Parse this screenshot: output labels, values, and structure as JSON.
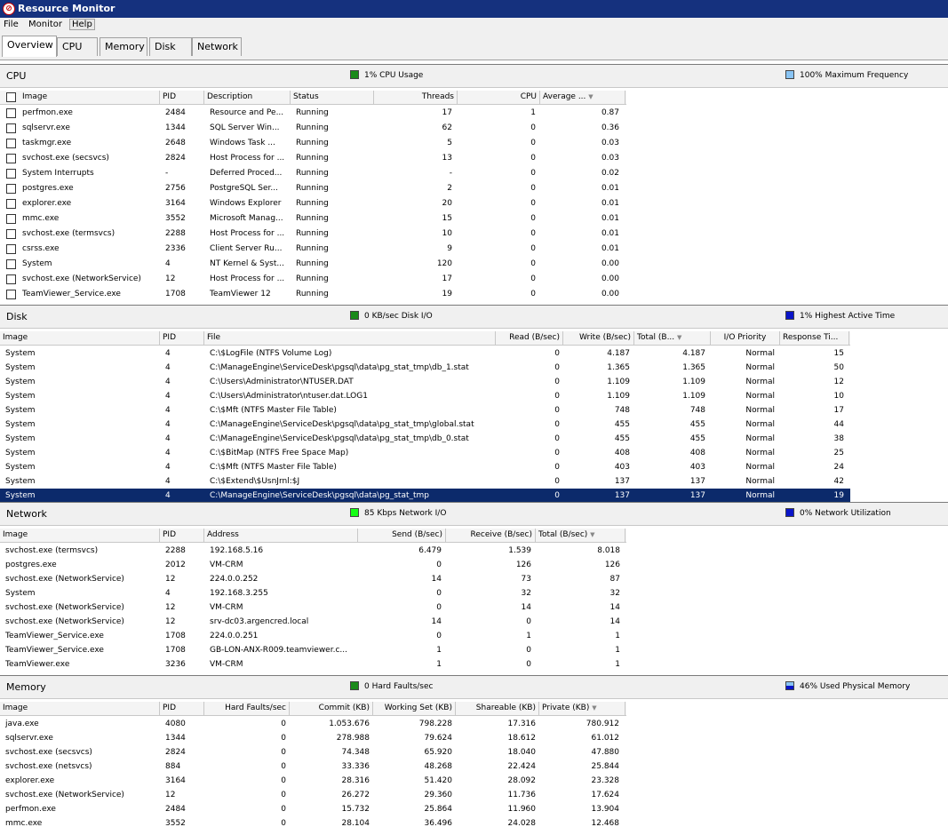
{
  "window": {
    "title": "Resource Monitor",
    "icon": "resource-monitor-icon"
  },
  "menu": [
    "File",
    "Monitor",
    "Help"
  ],
  "tabs": [
    "Overview",
    "CPU",
    "Memory",
    "Disk",
    "Network"
  ],
  "colors": {
    "green": "#1a8a1a",
    "lightblue": "#89c4f4",
    "blue": "#0a14c8",
    "brightgreen": "#14ff14",
    "selected": "#0c2a6b"
  },
  "cpu": {
    "title": "CPU",
    "indicator1": "1% CPU Usage",
    "indicator2": "100% Maximum Frequency",
    "columns": [
      "Image",
      "PID",
      "Description",
      "Status",
      "Threads",
      "CPU",
      "Average ..."
    ],
    "rows": [
      [
        "perfmon.exe",
        "2484",
        "Resource and Pe...",
        "Running",
        "17",
        "1",
        "0.87"
      ],
      [
        "sqlservr.exe",
        "1344",
        "SQL Server Win...",
        "Running",
        "62",
        "0",
        "0.36"
      ],
      [
        "taskmgr.exe",
        "2648",
        "Windows Task ...",
        "Running",
        "5",
        "0",
        "0.03"
      ],
      [
        "svchost.exe (secsvcs)",
        "2824",
        "Host Process for ...",
        "Running",
        "13",
        "0",
        "0.03"
      ],
      [
        "System Interrupts",
        "-",
        "Deferred Proced...",
        "Running",
        "-",
        "0",
        "0.02"
      ],
      [
        "postgres.exe",
        "2756",
        "PostgreSQL Ser...",
        "Running",
        "2",
        "0",
        "0.01"
      ],
      [
        "explorer.exe",
        "3164",
        "Windows Explorer",
        "Running",
        "20",
        "0",
        "0.01"
      ],
      [
        "mmc.exe",
        "3552",
        "Microsoft Manag...",
        "Running",
        "15",
        "0",
        "0.01"
      ],
      [
        "svchost.exe (termsvcs)",
        "2288",
        "Host Process for ...",
        "Running",
        "10",
        "0",
        "0.01"
      ],
      [
        "csrss.exe",
        "2336",
        "Client Server Ru...",
        "Running",
        "9",
        "0",
        "0.01"
      ],
      [
        "System",
        "4",
        "NT Kernel & Syst...",
        "Running",
        "120",
        "0",
        "0.00"
      ],
      [
        "svchost.exe (NetworkService)",
        "12",
        "Host Process for ...",
        "Running",
        "17",
        "0",
        "0.00"
      ],
      [
        "TeamViewer_Service.exe",
        "1708",
        "TeamViewer 12",
        "Running",
        "19",
        "0",
        "0.00"
      ]
    ]
  },
  "disk": {
    "title": "Disk",
    "indicator1": "0 KB/sec Disk I/O",
    "indicator2": "1% Highest Active Time",
    "columns": [
      "Image",
      "PID",
      "File",
      "Read (B/sec)",
      "Write (B/sec)",
      "Total (B...",
      "I/O Priority",
      "Response Ti..."
    ],
    "rows": [
      [
        "System",
        "4",
        "C:\\$LogFile (NTFS Volume Log)",
        "0",
        "4.187",
        "4.187",
        "Normal",
        "15"
      ],
      [
        "System",
        "4",
        "C:\\ManageEngine\\ServiceDesk\\pgsql\\data\\pg_stat_tmp\\db_1.stat",
        "0",
        "1.365",
        "1.365",
        "Normal",
        "50"
      ],
      [
        "System",
        "4",
        "C:\\Users\\Administrator\\NTUSER.DAT",
        "0",
        "1.109",
        "1.109",
        "Normal",
        "12"
      ],
      [
        "System",
        "4",
        "C:\\Users\\Administrator\\ntuser.dat.LOG1",
        "0",
        "1.109",
        "1.109",
        "Normal",
        "10"
      ],
      [
        "System",
        "4",
        "C:\\$Mft (NTFS Master File Table)",
        "0",
        "748",
        "748",
        "Normal",
        "17"
      ],
      [
        "System",
        "4",
        "C:\\ManageEngine\\ServiceDesk\\pgsql\\data\\pg_stat_tmp\\global.stat",
        "0",
        "455",
        "455",
        "Normal",
        "44"
      ],
      [
        "System",
        "4",
        "C:\\ManageEngine\\ServiceDesk\\pgsql\\data\\pg_stat_tmp\\db_0.stat",
        "0",
        "455",
        "455",
        "Normal",
        "38"
      ],
      [
        "System",
        "4",
        "C:\\$BitMap (NTFS Free Space Map)",
        "0",
        "408",
        "408",
        "Normal",
        "25"
      ],
      [
        "System",
        "4",
        "C:\\$Mft (NTFS Master File Table)",
        "0",
        "403",
        "403",
        "Normal",
        "24"
      ],
      [
        "System",
        "4",
        "C:\\$Extend\\$UsnJrnl:$J",
        "0",
        "137",
        "137",
        "Normal",
        "42"
      ],
      [
        "System",
        "4",
        "C:\\ManageEngine\\ServiceDesk\\pgsql\\data\\pg_stat_tmp",
        "0",
        "137",
        "137",
        "Normal",
        "19"
      ]
    ]
  },
  "network": {
    "title": "Network",
    "indicator1": "85 Kbps Network I/O",
    "indicator2": "0% Network Utilization",
    "columns": [
      "Image",
      "PID",
      "Address",
      "Send (B/sec)",
      "Receive (B/sec)",
      "Total (B/sec)"
    ],
    "rows": [
      [
        "svchost.exe (termsvcs)",
        "2288",
        "192.168.5.16",
        "6.479",
        "1.539",
        "8.018"
      ],
      [
        "postgres.exe",
        "2012",
        "VM-CRM",
        "0",
        "126",
        "126"
      ],
      [
        "svchost.exe (NetworkService)",
        "12",
        "224.0.0.252",
        "14",
        "73",
        "87"
      ],
      [
        "System",
        "4",
        "192.168.3.255",
        "0",
        "32",
        "32"
      ],
      [
        "svchost.exe (NetworkService)",
        "12",
        "VM-CRM",
        "0",
        "14",
        "14"
      ],
      [
        "svchost.exe (NetworkService)",
        "12",
        "srv-dc03.argencred.local",
        "14",
        "0",
        "14"
      ],
      [
        "TeamViewer_Service.exe",
        "1708",
        "224.0.0.251",
        "0",
        "1",
        "1"
      ],
      [
        "TeamViewer_Service.exe",
        "1708",
        "GB-LON-ANX-R009.teamviewer.c...",
        "1",
        "0",
        "1"
      ],
      [
        "TeamViewer.exe",
        "3236",
        "VM-CRM",
        "1",
        "0",
        "1"
      ]
    ]
  },
  "memory": {
    "title": "Memory",
    "indicator1": "0 Hard Faults/sec",
    "indicator2": "46% Used Physical Memory",
    "columns": [
      "Image",
      "PID",
      "Hard Faults/sec",
      "Commit (KB)",
      "Working Set (KB)",
      "Shareable (KB)",
      "Private (KB)"
    ],
    "rows": [
      [
        "java.exe",
        "4080",
        "0",
        "1.053.676",
        "798.228",
        "17.316",
        "780.912"
      ],
      [
        "sqlservr.exe",
        "1344",
        "0",
        "278.988",
        "79.624",
        "18.612",
        "61.012"
      ],
      [
        "svchost.exe (secsvcs)",
        "2824",
        "0",
        "74.348",
        "65.920",
        "18.040",
        "47.880"
      ],
      [
        "svchost.exe (netsvcs)",
        "884",
        "0",
        "33.336",
        "48.268",
        "22.424",
        "25.844"
      ],
      [
        "explorer.exe",
        "3164",
        "0",
        "28.316",
        "51.420",
        "28.092",
        "23.328"
      ],
      [
        "svchost.exe (NetworkService)",
        "12",
        "0",
        "26.272",
        "29.360",
        "11.736",
        "17.624"
      ],
      [
        "perfmon.exe",
        "2484",
        "0",
        "15.732",
        "25.864",
        "11.960",
        "13.904"
      ],
      [
        "mmc.exe",
        "3552",
        "0",
        "28.104",
        "36.496",
        "24.028",
        "12.468"
      ]
    ]
  }
}
